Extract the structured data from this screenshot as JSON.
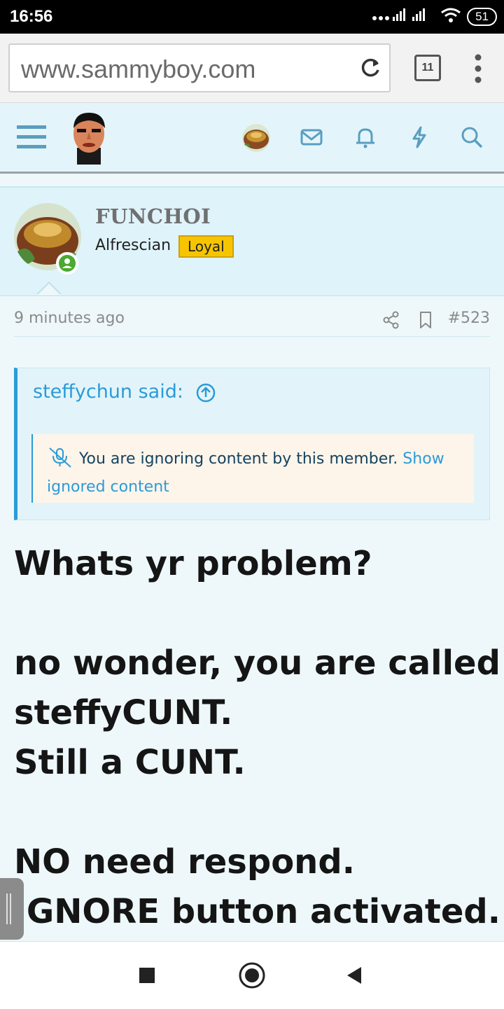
{
  "status_bar": {
    "time": "16:56",
    "battery": "51"
  },
  "browser": {
    "url": "www.sammyboy.com",
    "tab_count": "11"
  },
  "header": {
    "icons": [
      "menu-icon",
      "inbox-icon",
      "bell-icon",
      "bolt-icon",
      "search-icon"
    ]
  },
  "post": {
    "author": "FUNCHOI",
    "user_title": "Alfrescian",
    "badge": "Loyal",
    "time": "9 minutes ago",
    "number": "#523",
    "quote": {
      "author_said": "steffychun said:",
      "ignored_text": "You are ignoring content by this member.",
      "show_link": "Show ignored content"
    },
    "body_lines": [
      "Whats yr problem?",
      "",
      "no wonder, you are called",
      "steffyCUNT.",
      "Still a CUNT.",
      "",
      "NO need respond.",
      "IGNORE button activated."
    ]
  },
  "colors": {
    "accent": "#2b9bd8",
    "badge": "#f7c500",
    "online": "#49a930",
    "header_bg": "#e3f5fb"
  }
}
